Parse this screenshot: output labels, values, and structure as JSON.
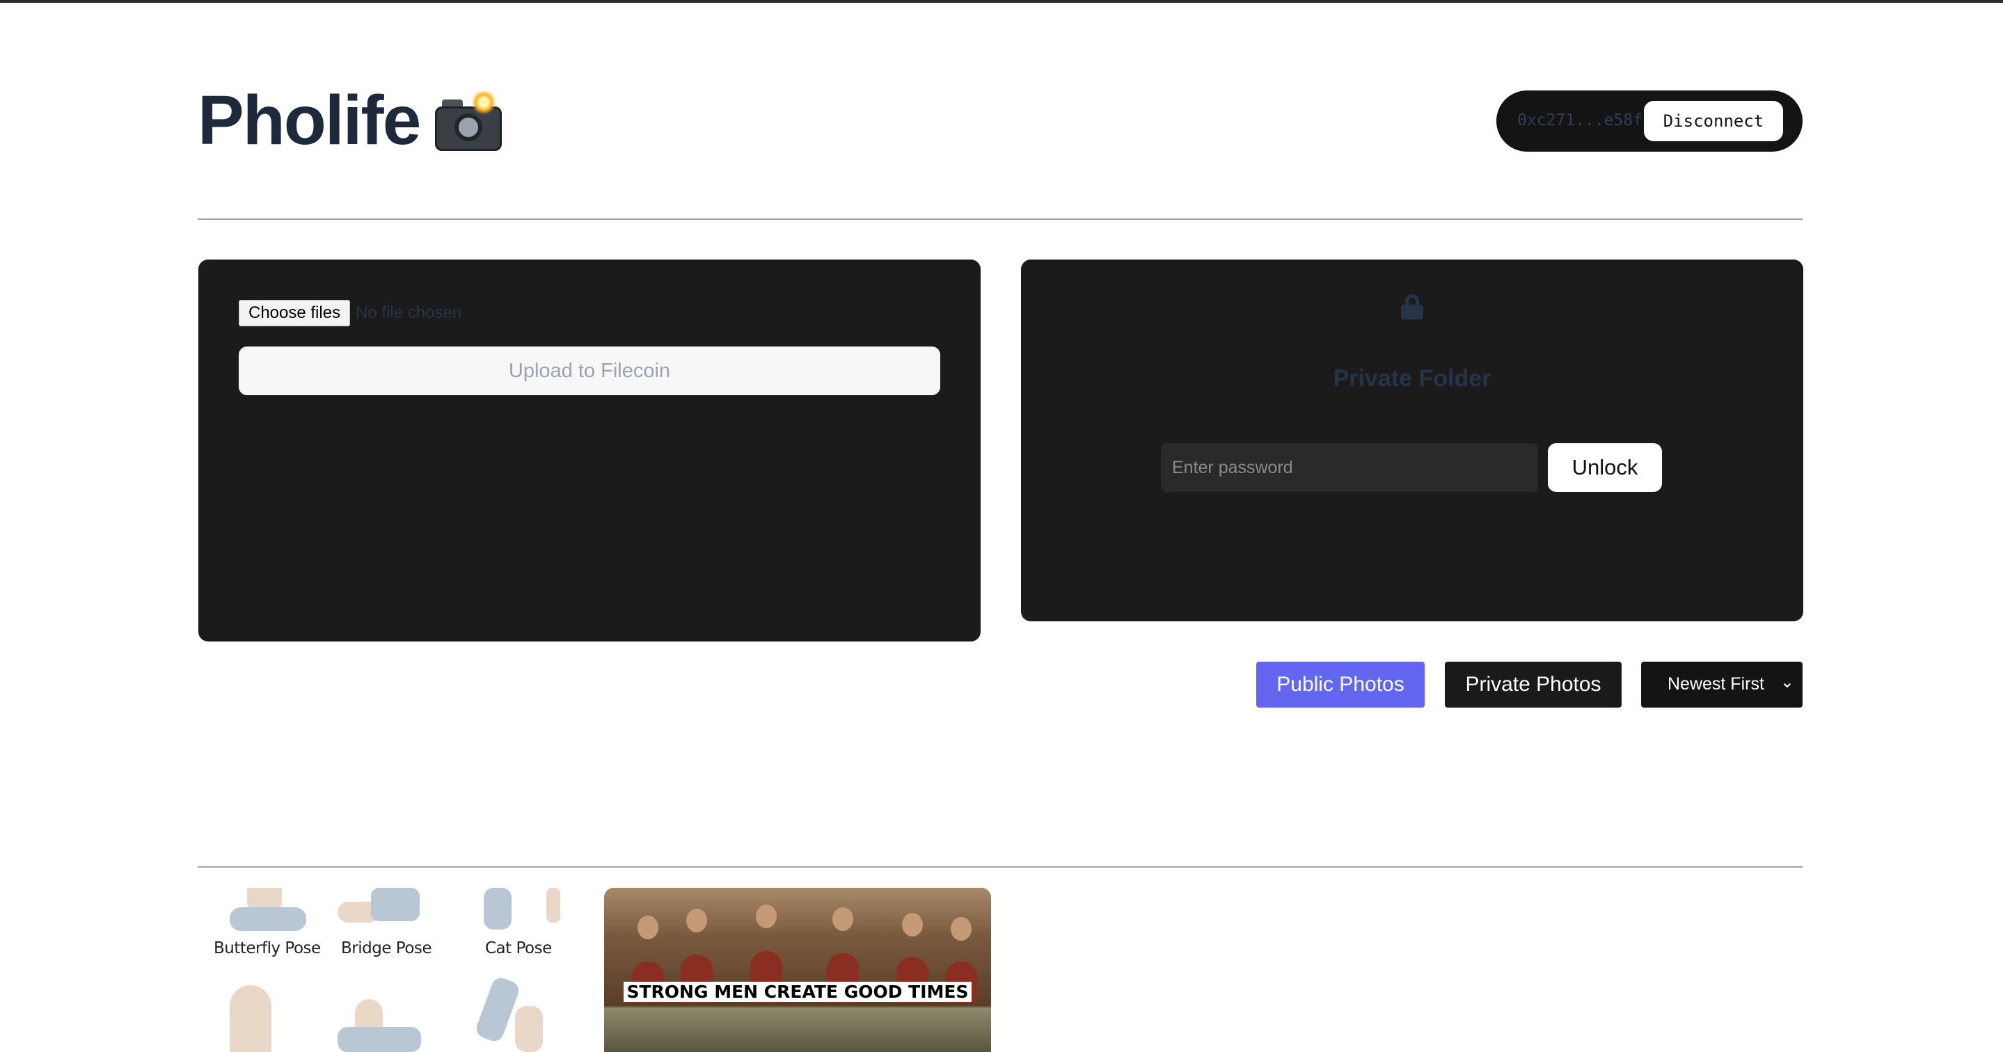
{
  "header": {
    "title": "Pholife",
    "icon": "camera-flash-icon"
  },
  "wallet": {
    "address": "0xc271...e58f",
    "disconnect_label": "Disconnect"
  },
  "upload": {
    "choose_label": "Choose files",
    "file_status": "No file chosen",
    "upload_label": "Upload to Filecoin"
  },
  "private_folder": {
    "icon": "lock-icon",
    "title": "Private Folder",
    "password_placeholder": "Enter password",
    "unlock_label": "Unlock"
  },
  "filters": {
    "public_label": "Public Photos",
    "private_label": "Private Photos",
    "sort_value": "Newest First",
    "active_color": "#6366f1"
  },
  "gallery": {
    "photo1": {
      "poses": [
        "Butterfly Pose",
        "Bridge Pose",
        "Cat Pose"
      ]
    },
    "photo2": {
      "caption": "STRONG MEN CREATE GOOD TIMES"
    }
  }
}
